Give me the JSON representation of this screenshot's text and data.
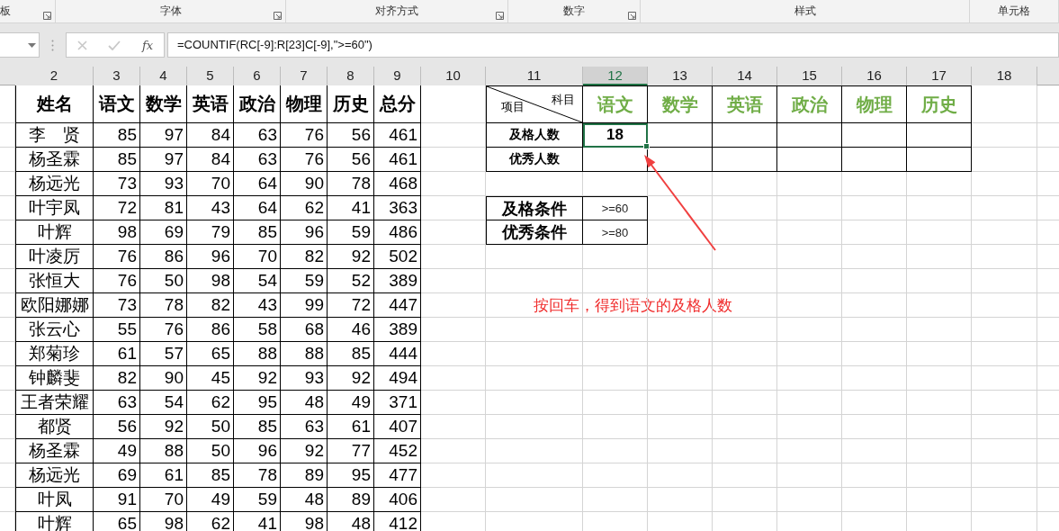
{
  "ribbon_groups": [
    {
      "label": "板",
      "launcher": true
    },
    {
      "label": "字体",
      "launcher": true
    },
    {
      "label": "对齐方式",
      "launcher": true
    },
    {
      "label": "数字",
      "launcher": true
    },
    {
      "label": "样式",
      "launcher": false
    },
    {
      "label": "单元格",
      "launcher": false
    }
  ],
  "formula_bar": {
    "function_label": "fx",
    "formula": "=COUNTIF(RC[-9]:R[23]C[-9],\">=60\")"
  },
  "column_headers": [
    {
      "label": "2",
      "selected": false
    },
    {
      "label": "3",
      "selected": false
    },
    {
      "label": "4",
      "selected": false
    },
    {
      "label": "5",
      "selected": false
    },
    {
      "label": "6",
      "selected": false
    },
    {
      "label": "7",
      "selected": false
    },
    {
      "label": "8",
      "selected": false
    },
    {
      "label": "9",
      "selected": false
    },
    {
      "label": "10",
      "selected": false
    },
    {
      "label": "11",
      "selected": false
    },
    {
      "label": "12",
      "selected": true
    },
    {
      "label": "13",
      "selected": false
    },
    {
      "label": "14",
      "selected": false
    },
    {
      "label": "15",
      "selected": false
    },
    {
      "label": "16",
      "selected": false
    },
    {
      "label": "17",
      "selected": false
    },
    {
      "label": "18",
      "selected": false
    }
  ],
  "score_table": {
    "columns": [
      "姓名",
      "语文",
      "数学",
      "英语",
      "政治",
      "物理",
      "历史",
      "总分"
    ],
    "rows": [
      [
        "李　贤",
        "85",
        "97",
        "84",
        "63",
        "76",
        "56",
        "461"
      ],
      [
        "杨圣霖",
        "85",
        "97",
        "84",
        "63",
        "76",
        "56",
        "461"
      ],
      [
        "杨远光",
        "73",
        "93",
        "70",
        "64",
        "90",
        "78",
        "468"
      ],
      [
        "叶宇凤",
        "72",
        "81",
        "43",
        "64",
        "62",
        "41",
        "363"
      ],
      [
        "叶辉",
        "98",
        "69",
        "79",
        "85",
        "96",
        "59",
        "486"
      ],
      [
        "叶凌厉",
        "76",
        "86",
        "96",
        "70",
        "82",
        "92",
        "502"
      ],
      [
        "张恒大",
        "76",
        "50",
        "98",
        "54",
        "59",
        "52",
        "389"
      ],
      [
        "欧阳娜娜",
        "73",
        "78",
        "82",
        "43",
        "99",
        "72",
        "447"
      ],
      [
        "张云心",
        "55",
        "76",
        "86",
        "58",
        "68",
        "46",
        "389"
      ],
      [
        "郑菊珍",
        "61",
        "57",
        "65",
        "88",
        "88",
        "85",
        "444"
      ],
      [
        "钟麟斐",
        "82",
        "90",
        "45",
        "92",
        "93",
        "92",
        "494"
      ],
      [
        "王者荣耀",
        "63",
        "54",
        "62",
        "95",
        "48",
        "49",
        "371"
      ],
      [
        "都贤",
        "56",
        "92",
        "50",
        "85",
        "63",
        "61",
        "407"
      ],
      [
        "杨圣霖",
        "49",
        "88",
        "50",
        "96",
        "92",
        "77",
        "452"
      ],
      [
        "杨远光",
        "69",
        "61",
        "85",
        "78",
        "89",
        "95",
        "477"
      ],
      [
        "叶凤",
        "91",
        "70",
        "49",
        "59",
        "48",
        "89",
        "406"
      ],
      [
        "叶辉",
        "65",
        "98",
        "62",
        "41",
        "98",
        "48",
        "412"
      ]
    ]
  },
  "summary_table": {
    "corner_top": "科目",
    "corner_bottom": "项目",
    "subjects": [
      "语文",
      "数学",
      "英语",
      "政治",
      "物理",
      "历史"
    ],
    "rows": [
      {
        "label": "及格人数",
        "cells": [
          {
            "value": "18",
            "selected": true
          },
          {
            "selected": false
          },
          {
            "selected": false
          },
          {
            "selected": false
          },
          {
            "selected": false
          },
          {
            "selected": false
          }
        ]
      },
      {
        "label": "优秀人数",
        "cells": [
          {
            "selected": false
          },
          {
            "selected": false
          },
          {
            "selected": false
          },
          {
            "selected": false
          },
          {
            "selected": false
          },
          {
            "selected": false
          }
        ]
      }
    ]
  },
  "criteria": [
    {
      "label": "及格条件",
      "value": ">=60"
    },
    {
      "label": "优秀条件",
      "value": ">=80"
    }
  ],
  "annotation": {
    "text": "按回车，得到语文的及格人数"
  }
}
